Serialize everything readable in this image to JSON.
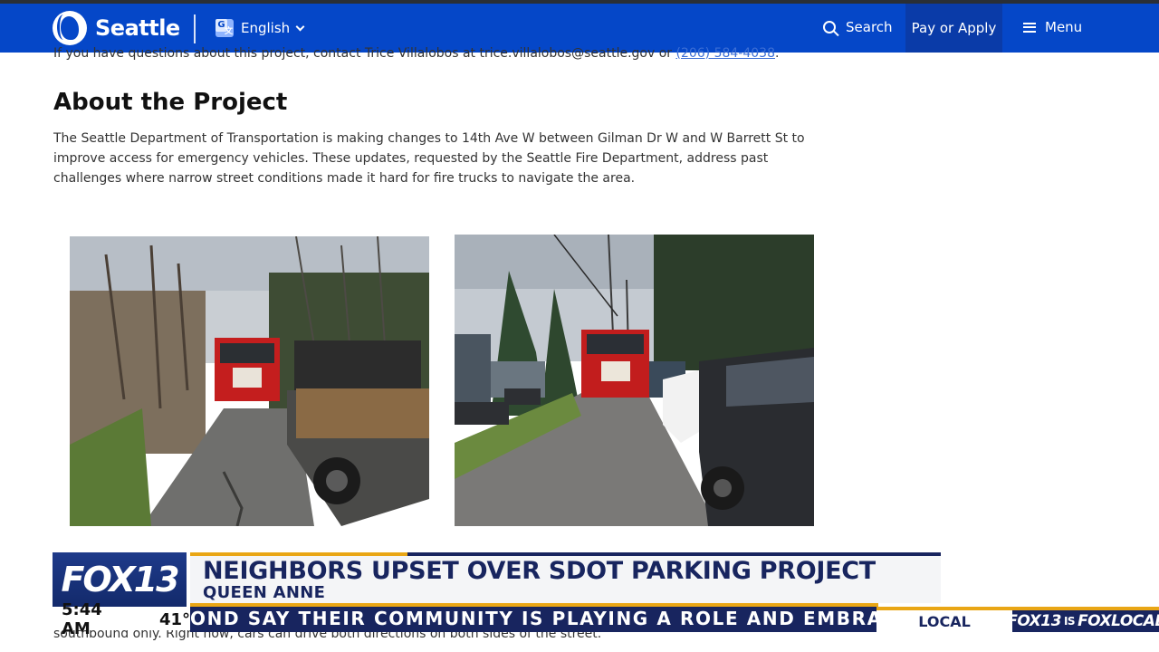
{
  "header": {
    "logo_text": "Seattle",
    "language": "English",
    "search_label": "Search",
    "pay_label": "Pay or Apply",
    "menu_label": "Menu",
    "colors": {
      "brand_blue": "#0547c8",
      "pay_bg": "#0a3ba8"
    }
  },
  "content": {
    "contact_prefix": "If you have questions about this project, contact Trice Villalobos at trice.villalobos@seattle.gov or ",
    "contact_phone": "(206) 584-4038",
    "contact_suffix": ".",
    "about_title": "About the Project",
    "about_body": "The Seattle Department of Transportation is making changes to 14th Ave W between Gilman Dr W and W Barrett St to improve access for emergency vehicles. These updates, requested by the Seattle Fire Department, address past challenges where narrow street conditions made it hard for fire trucks to navigate the area.",
    "photos": [
      {
        "description_icon": "fire-truck-photo"
      },
      {
        "description_icon": "fire-truck-photo"
      }
    ],
    "bottom_text": "southbound only. Right now, cars can drive both directions on both sides of the street."
  },
  "broadcast": {
    "station_logo": "FOX13",
    "headline": "NEIGHBORS UPSET OVER SDOT PARKING PROJECT",
    "subheadline": "QUEEN ANNE",
    "time": "5:44 AM",
    "temperature": "41°",
    "ticker": "OND SAY THEIR COMMUNITY IS PLAYING A ROLE AND EMBRACING A",
    "section": "LOCAL",
    "brand_left": "FOX13",
    "brand_mid": "IS",
    "brand_right": "FOXLOCAL",
    "colors": {
      "navy": "#18255f",
      "gold": "#e9a615"
    }
  }
}
